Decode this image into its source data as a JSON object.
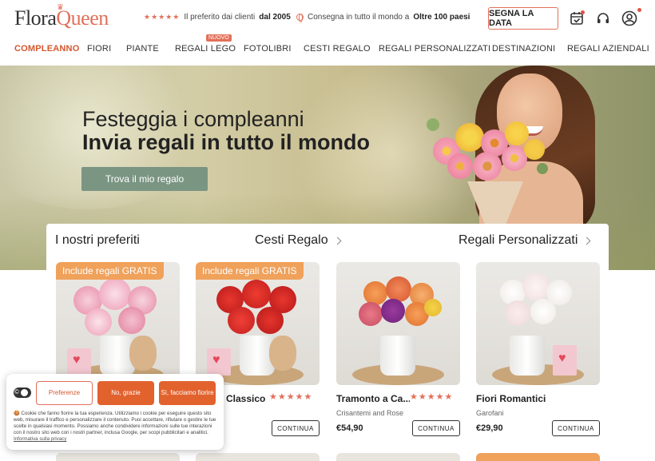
{
  "brand": {
    "name_part1": "Flora",
    "name_part2": "Queen"
  },
  "trust": {
    "rating_stars": "★★★★★",
    "rating_text": "Il preferito dai clienti",
    "rating_since": "dal 2005",
    "ship_text": "Consegna in tutto il mondo a",
    "ship_count": "Oltre 100 paesi"
  },
  "header": {
    "date_button": "SEGNA LA DATA"
  },
  "nav": {
    "items": [
      "COMPLEANNO",
      "FIORI",
      "PIANTE",
      "REGALI LEGO",
      "FOTOLIBRI",
      "CESTI REGALO",
      "REGALI PERSONALIZZATI",
      "DESTINAZIONI",
      "REGALI AZIENDALI"
    ],
    "new_badge": "NUOVO"
  },
  "hero": {
    "title_line1": "Festeggia i compleanni",
    "title_line2": "Invia regali in tutto il mondo",
    "cta": "Trova il mio regalo"
  },
  "sections": {
    "favorites": "I nostri preferiti",
    "baskets": "Cesti Regalo",
    "personalized": "Regali Personalizzati"
  },
  "products": [
    {
      "promo": "Include regali GRATIS",
      "name": "",
      "stars": "",
      "subtitle": "",
      "price": "",
      "button": ""
    },
    {
      "promo": "Include regali GRATIS",
      "name": "Classico",
      "stars": "★★★★★",
      "subtitle": "",
      "price": "",
      "button": "CONTINUA"
    },
    {
      "promo": "",
      "name": "Tramonto a Ca...",
      "stars": "★★★★★",
      "subtitle": "Crisantemi and Rose",
      "price": "€54,90",
      "button": "CONTINUA"
    },
    {
      "promo": "",
      "name": "Fiori Romantici",
      "stars": "",
      "subtitle": "Garofani",
      "price": "€29,90",
      "button": "CONTINUA"
    }
  ],
  "cookie": {
    "preferences": "Preferenze",
    "decline": "No, grazie",
    "accept": "Sì, facciamo fiorire",
    "text": "🍪 Cookie che fanno fiorire la tua esperienza. Utilizziamo i cookie per eseguire questo sito web, misurare il traffico e personalizzare il contenuto. Puoi accettare, rifiutare o gestire le tue scelte in qualsiasi momento. Possiamo anche condividere informazioni sulle tue interazioni con il nostro sito web con i nostri partner, inclusa Google, per scopi pubblicitari e analitici.",
    "link": "Informativa sulla privacy"
  },
  "colors": {
    "accent": "#e2705a",
    "nav_active": "#d4572e",
    "hero_button": "#7b9583",
    "promo": "#f0a15a",
    "cookie_button": "#e2622e"
  }
}
